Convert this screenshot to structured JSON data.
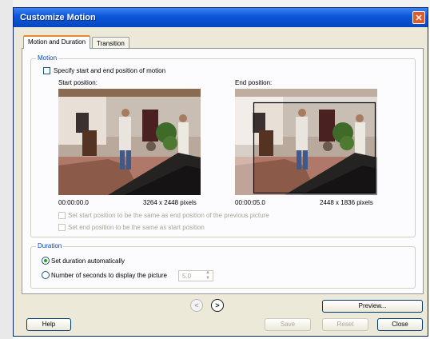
{
  "window": {
    "title": "Customize Motion"
  },
  "tabs": [
    {
      "label": "Motion and Duration",
      "active": true
    },
    {
      "label": "Transition",
      "active": false
    }
  ],
  "motion": {
    "legend": "Motion",
    "specify_label": "Specify start and end position of motion",
    "specify_checked": false,
    "start": {
      "heading": "Start position:",
      "time": "00:00:00.0",
      "size": "3264 x 2448 pixels"
    },
    "end": {
      "heading": "End position:",
      "time": "00:00:05.0",
      "size": "2448 x 1836 pixels"
    },
    "same_as_prev_label": "Set start position to be the same as end position of the previous picture",
    "same_as_start_label": "Set end position to be the same as start position"
  },
  "duration": {
    "legend": "Duration",
    "auto_label": "Set duration automatically",
    "seconds_label": "Number of seconds to display the picture",
    "seconds_value": "5.0",
    "selected": "auto"
  },
  "buttons": {
    "preview": "Preview...",
    "help": "Help",
    "save": "Save",
    "reset": "Reset",
    "close": "Close"
  },
  "icons": {
    "back": "back-arrow-icon",
    "forward": "forward-arrow-icon",
    "close": "close-x-icon"
  },
  "colors": {
    "titlebar": "#0a56d9",
    "accent_tab": "#e68b2c",
    "legend": "#0046d5",
    "radio_dot": "#21a121"
  }
}
